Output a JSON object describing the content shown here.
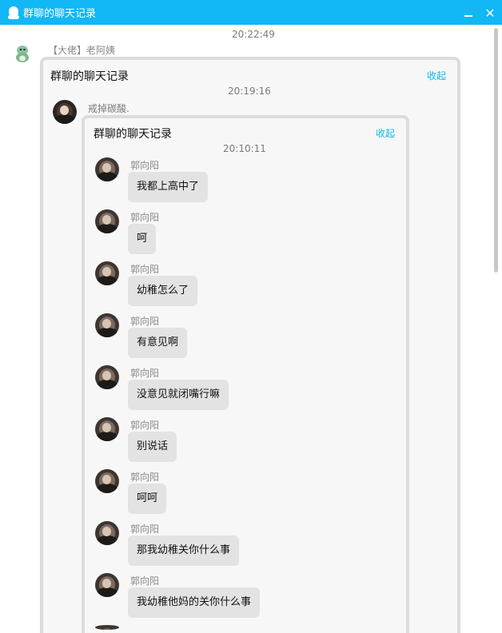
{
  "window": {
    "title": "群聊的聊天记录"
  },
  "outer": {
    "timestamp": "20:22:49",
    "sender": "【大佬】老阿姨",
    "card": {
      "title": "群聊的聊天记录",
      "collapse_label": "收起",
      "timestamp": "20:19:16",
      "sender_text": "戒掉碳酸.",
      "inner_card": {
        "title": "群聊的聊天记录",
        "collapse_label": "收起",
        "timestamp": "20:10:11",
        "messages": [
          {
            "name": "郭向阳",
            "text": "我都上高中了"
          },
          {
            "name": "郭向阳",
            "text": "呵"
          },
          {
            "name": "郭向阳",
            "text": "幼稚怎么了"
          },
          {
            "name": "郭向阳",
            "text": "有意见啊"
          },
          {
            "name": "郭向阳",
            "text": "没意见就闭嘴行嘛"
          },
          {
            "name": "郭向阳",
            "text": "别说话"
          },
          {
            "name": "郭向阳",
            "text": "呵呵"
          },
          {
            "name": "郭向阳",
            "text": "那我幼稚关你什么事"
          },
          {
            "name": "郭向阳",
            "text": "我幼稚他妈的关你什么事"
          }
        ]
      }
    }
  },
  "icons": {
    "app": "qq-penguin-icon",
    "minimize": "minimize-icon",
    "close": "close-icon",
    "dino_avatar": "dinosaur-avatar-icon"
  },
  "colors": {
    "titlebar": "#12b7f5",
    "accent": "#12b7f5",
    "bubble": "#e3e3e3",
    "card": "#f7f7f7"
  }
}
